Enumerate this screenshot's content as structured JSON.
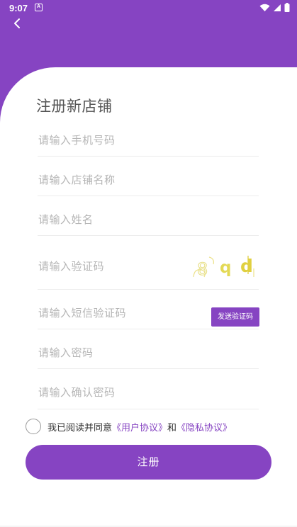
{
  "status": {
    "time": "9:07",
    "notification_icon": "a-icon",
    "icons": [
      "wifi-icon",
      "signal-icon",
      "battery-icon"
    ]
  },
  "colors": {
    "accent": "#8644c2",
    "placeholder": "#b5b5b5",
    "divider": "#ececec",
    "captcha": "#e8d94a"
  },
  "header": {
    "back_icon": "chevron-left-icon"
  },
  "form": {
    "title": "注册新店铺",
    "phone_placeholder": "请输入手机号码",
    "shop_name_placeholder": "请输入店铺名称",
    "name_placeholder": "请输入姓名",
    "captcha_placeholder": "请输入验证码",
    "captcha_text": "8qd",
    "sms_placeholder": "请输入短信验证码",
    "sms_button": "发送验证码",
    "password_placeholder": "请输入密码",
    "confirm_password_placeholder": "请输入确认密码"
  },
  "agreement": {
    "checked": false,
    "prefix": "我已阅读并同意",
    "user_agreement": "《用户协议》",
    "and": "和",
    "privacy_agreement": "《隐私协议》"
  },
  "submit_label": "注册"
}
